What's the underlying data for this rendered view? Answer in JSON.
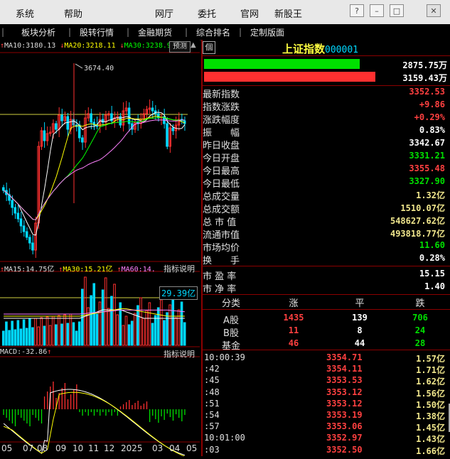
{
  "menubar": {
    "items": [
      "系统",
      "帮助",
      "网厅",
      "委托",
      "官网",
      "新股王"
    ],
    "buttons": [
      "?",
      "–",
      "□",
      "✕"
    ]
  },
  "submenu": {
    "items": [
      "板块分析",
      "股转行情",
      "金融期货",
      "综合排名",
      "定制版面"
    ]
  },
  "chart": {
    "ma_top": {
      "ma10": "MA10:3180.13",
      "ma20": "MA20:3218.11",
      "ma30": "MA30:3238.9"
    },
    "predict_label": "预测",
    "peak_label": "3674.40",
    "vol_header": {
      "ma15": "MA15:14.75亿",
      "ma30": "MA30:15.21亿",
      "ma60": "MA60:14."
    },
    "indicator_label": "指标说明",
    "vol_current": "29.39亿",
    "macd_header": "MACD:-32.86",
    "x_labels": [
      "05",
      "07",
      "08",
      "09",
      "10",
      "11",
      "12",
      "2025",
      "03",
      "04",
      "05"
    ]
  },
  "panel": {
    "icon_label": "個",
    "index_name": "上证指数",
    "index_code": "000001",
    "bar_green_value": "2875.75万",
    "bar_red_value": "3159.43万",
    "bar_green_ratio": 0.877,
    "bar_red_ratio": 0.963,
    "stats": [
      {
        "label": "最新指数",
        "value": "3352.53",
        "color": "red"
      },
      {
        "label": "指数涨跌",
        "value": "+9.86",
        "color": "red"
      },
      {
        "label": "涨跌幅度",
        "value": "+0.29%",
        "color": "red"
      },
      {
        "label": "振　　幅",
        "value": "0.83%",
        "color": "white"
      },
      {
        "label": "昨日收盘",
        "value": "3342.67",
        "color": "white"
      },
      {
        "label": "今日开盘",
        "value": "3331.21",
        "color": "green"
      },
      {
        "label": "今日最高",
        "value": "3355.48",
        "color": "red"
      },
      {
        "label": "今日最低",
        "value": "3327.90",
        "color": "green"
      },
      {
        "label": "总成交量",
        "value": "1.32亿",
        "color": "yellow"
      },
      {
        "label": "总成交额",
        "value": "1510.07亿",
        "color": "yellow"
      },
      {
        "label": "总 市 值",
        "value": "548627.62亿",
        "color": "yellow"
      },
      {
        "label": "流通市值",
        "value": "493818.77亿",
        "color": "yellow"
      },
      {
        "label": "市场均价",
        "value": "11.60",
        "color": "green"
      },
      {
        "label": "换　　手",
        "value": "0.28%",
        "color": "white"
      }
    ],
    "ratios": [
      {
        "label": "市 盈 率",
        "value": "15.15"
      },
      {
        "label": "市 净 率",
        "value": "1.40"
      }
    ],
    "classify": {
      "headers": [
        "分类",
        "涨",
        "平",
        "跌"
      ],
      "rows": [
        {
          "name": "A股",
          "up": "1435",
          "flat": "139",
          "down": "706"
        },
        {
          "name": "B股",
          "up": "11",
          "flat": "8",
          "down": "24"
        },
        {
          "name": "基金",
          "up": "46",
          "flat": "44",
          "down": "28"
        }
      ]
    },
    "ticks": [
      {
        "time": "10:00:39",
        "price": "3354.71",
        "vol": "1.57亿"
      },
      {
        "time": ":42",
        "price": "3354.11",
        "vol": "1.71亿"
      },
      {
        "time": ":45",
        "price": "3353.53",
        "vol": "1.62亿"
      },
      {
        "time": ":48",
        "price": "3353.12",
        "vol": "1.56亿"
      },
      {
        "time": ":51",
        "price": "3353.12",
        "vol": "1.50亿"
      },
      {
        "time": ":54",
        "price": "3353.19",
        "vol": "1.38亿"
      },
      {
        "time": ":57",
        "price": "3353.06",
        "vol": "1.45亿"
      },
      {
        "time": "10:01:00",
        "price": "3352.97",
        "vol": "1.43亿"
      },
      {
        "time": ":03",
        "price": "3352.50",
        "vol": "1.66亿"
      }
    ]
  },
  "colors": {
    "up": "#ff3030",
    "down": "#00d8ff",
    "ma10": "#ffffff",
    "ma20": "#ffff00",
    "ma30": "#00ff00"
  }
}
